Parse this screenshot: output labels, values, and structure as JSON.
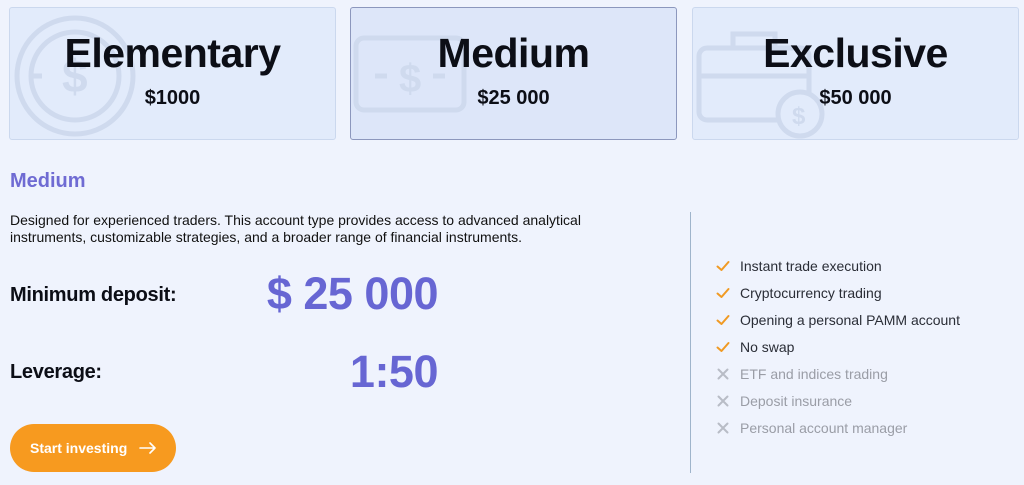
{
  "plans": [
    {
      "name": "Elementary",
      "price": "$1000"
    },
    {
      "name": "Medium",
      "price": "$25 000"
    },
    {
      "name": "Exclusive",
      "price": "$50 000"
    }
  ],
  "selected": {
    "title": "Medium",
    "description": "Designed for experienced traders. This account type provides access to advanced analytical instruments, customizable strategies, and a broader range of financial instruments.",
    "min_deposit_label": "Minimum deposit:",
    "min_deposit_value": "$ 25 000",
    "leverage_label": "Leverage:",
    "leverage_value": "1:50",
    "cta_label": "Start investing"
  },
  "features": [
    {
      "label": "Instant trade execution",
      "included": true
    },
    {
      "label": "Cryptocurrency trading",
      "included": true
    },
    {
      "label": "Opening a personal PAMM account",
      "included": true
    },
    {
      "label": "No swap",
      "included": true
    },
    {
      "label": "ETF and indices trading",
      "included": false
    },
    {
      "label": "Deposit insurance",
      "included": false
    },
    {
      "label": "Personal account manager",
      "included": false
    }
  ],
  "colors": {
    "accent": "#6766d3",
    "cta": "#f79a1f",
    "check": "#f09a23",
    "cross": "#b8bcc6"
  },
  "icons": {
    "elementary": "coin-icon",
    "medium": "banknote-icon",
    "exclusive": "briefcase-coin-icon",
    "cta": "arrow-right-icon"
  }
}
